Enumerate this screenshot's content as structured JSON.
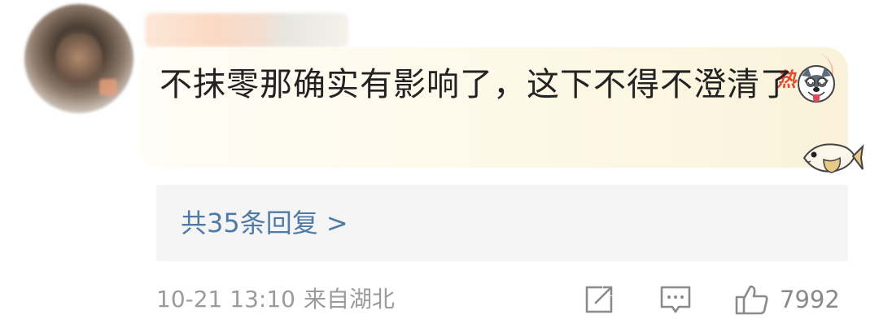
{
  "comment": {
    "badge": "热评",
    "text": "不抹零那确实有影响了，这下不得不澄清了",
    "emoji_icon": "husky-dog-tongue-emoji",
    "sticker_icon": "fish-sticker-icon"
  },
  "replies": {
    "label": "共35条回复 >"
  },
  "meta": {
    "timestamp": "10-21 13:10",
    "location": "来自湖北"
  },
  "actions": {
    "share_icon": "share-icon",
    "comment_icon": "comment-icon",
    "like_icon": "thumbs-up-icon",
    "like_count": "7992"
  },
  "colors": {
    "badge_red": "#e64a2e",
    "link_blue": "#4f7aa5",
    "meta_gray": "#9b9b9b",
    "card_bg": "#fdf8e6",
    "reply_bg": "#f5f5f5"
  }
}
